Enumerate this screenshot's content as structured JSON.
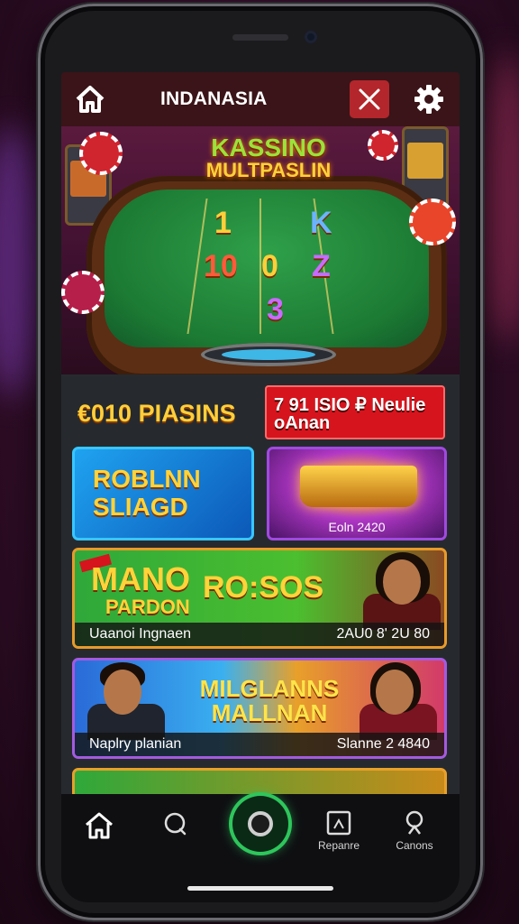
{
  "header": {
    "title": "INDANASIA",
    "home_icon": "home-icon",
    "close_icon": "close-icon",
    "settings_icon": "gear-icon",
    "close_color": "#b3262b"
  },
  "hero": {
    "title_line1": "KASSINO",
    "title_line2": "MULTPASLIN",
    "symbols": [
      "1",
      "K",
      "10",
      "0",
      "Z",
      "3"
    ]
  },
  "promos": {
    "left_label": "€010 PIASINS",
    "right_label": "7 91 ISIO ₽ Neulie oAnan"
  },
  "cards": [
    {
      "title": "ROBLNN SLIAGD",
      "caption": ""
    },
    {
      "title": "",
      "caption": "Eoln 2420"
    }
  ],
  "banners": [
    {
      "title_line1": "MANO",
      "title_line2": "PARDON",
      "subtitle": "RO:SOS",
      "caption_left": "Uaanoi Ingnaen",
      "caption_right": "2AU0 8' 2U 80"
    },
    {
      "title": "MILGLANNS MALLNAN",
      "caption_left": "Naplry planian",
      "caption_right": "Slanne 2 4840"
    }
  ],
  "bottom_nav": [
    {
      "icon": "home-icon",
      "label": ""
    },
    {
      "icon": "search-icon",
      "label": ""
    },
    {
      "icon": "play-icon",
      "label": ""
    },
    {
      "icon": "receipt-icon",
      "label": "Repanre"
    },
    {
      "icon": "profile-icon",
      "label": "Canons"
    }
  ],
  "colors": {
    "accent_green": "#2ec65c",
    "gold_text": "#ffd33a",
    "header_bg": "#3a1418"
  }
}
